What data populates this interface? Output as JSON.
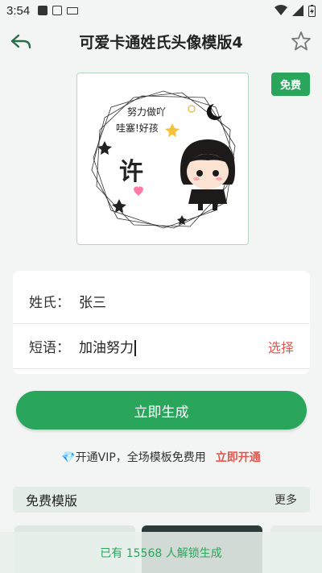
{
  "status_bar": {
    "time": "3:54"
  },
  "header": {
    "title": "可爱卡通姓氏头像模版4"
  },
  "preview": {
    "surname_char": "许",
    "deco_text_1": "努力做吖",
    "deco_text_2": "哇塞!好孩"
  },
  "badge": {
    "label": "免费"
  },
  "form": {
    "surname_label": "姓氏：",
    "surname_value": "张三",
    "phrase_label": "短语：",
    "phrase_value": "加油努力",
    "select_label": "选择"
  },
  "generate_button": {
    "label": "立即生成"
  },
  "vip": {
    "text": "💎开通VIP，全场模板免费用",
    "link": "立即开通"
  },
  "free_templates": {
    "title": "免费模版",
    "more": "更多"
  },
  "bottom_bar": {
    "text": "已有 15568 人解锁生成"
  },
  "colors": {
    "accent": "#2aa65c",
    "link_red": "#e0584f",
    "background": "#f2f5f4"
  }
}
